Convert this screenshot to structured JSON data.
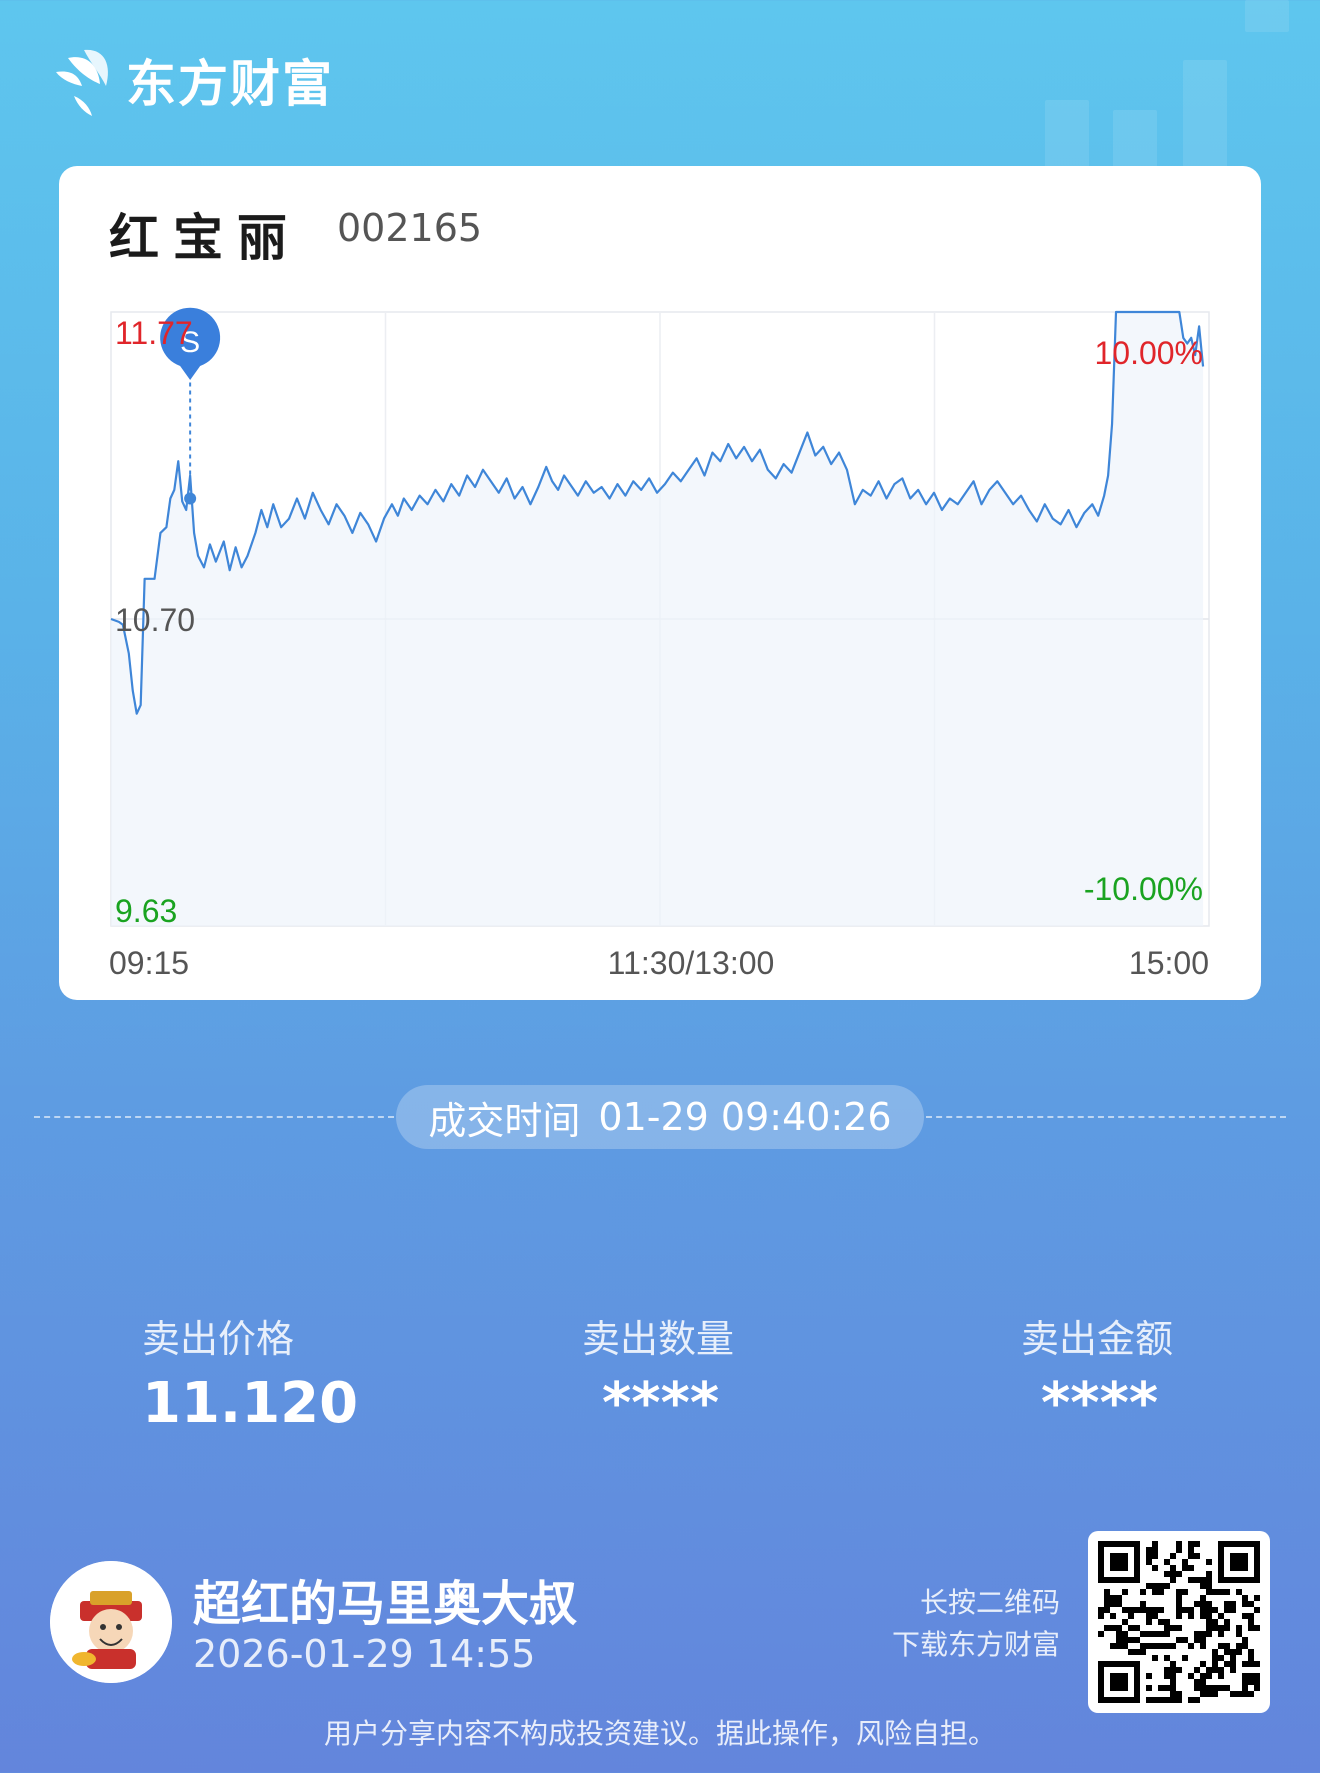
{
  "brand": {
    "name": "东方财富",
    "logo_icon": "eastmoney-leaf-icon"
  },
  "stock": {
    "name": "红宝丽",
    "code": "002165"
  },
  "chart_data": {
    "type": "line",
    "title": "",
    "xlabel": "",
    "ylabel": "",
    "x_ticks": [
      "09:15",
      "11:30/13:00",
      "15:00"
    ],
    "y_ticks_left": {
      "high": "11.77",
      "mid": "10.70",
      "low": "9.63"
    },
    "y_ticks_right": {
      "high": "10.00%",
      "low": "-10.00%"
    },
    "ylim": [
      9.63,
      11.77
    ],
    "prev_close": 10.7,
    "grid": true,
    "line_color": "#3f86d8",
    "high_color": "#e0252a",
    "low_color": "#1aa320",
    "series": [
      {
        "points": [
          [
            0,
            10.7
          ],
          [
            0.04,
            10.69
          ],
          [
            0.06,
            10.68
          ],
          [
            0.09,
            10.58
          ],
          [
            0.11,
            10.45
          ],
          [
            0.13,
            10.37
          ],
          [
            0.15,
            10.4
          ],
          [
            0.17,
            10.84
          ],
          [
            0.22,
            10.84
          ],
          [
            0.25,
            11.0
          ],
          [
            0.28,
            11.02
          ],
          [
            0.3,
            11.12
          ],
          [
            0.32,
            11.15
          ],
          [
            0.34,
            11.25
          ],
          [
            0.36,
            11.11
          ],
          [
            0.38,
            11.08
          ],
          [
            0.4,
            11.2
          ],
          [
            0.42,
            11.0
          ],
          [
            0.44,
            10.92
          ],
          [
            0.47,
            10.88
          ],
          [
            0.5,
            10.96
          ],
          [
            0.53,
            10.9
          ],
          [
            0.57,
            10.97
          ],
          [
            0.6,
            10.87
          ],
          [
            0.63,
            10.95
          ],
          [
            0.66,
            10.88
          ],
          [
            0.69,
            10.92
          ],
          [
            0.73,
            11.0
          ],
          [
            0.76,
            11.08
          ],
          [
            0.79,
            11.02
          ],
          [
            0.82,
            11.1
          ],
          [
            0.86,
            11.02
          ],
          [
            0.9,
            11.05
          ],
          [
            0.94,
            11.12
          ],
          [
            0.98,
            11.05
          ],
          [
            1.02,
            11.14
          ],
          [
            1.06,
            11.08
          ],
          [
            1.1,
            11.03
          ],
          [
            1.14,
            11.1
          ],
          [
            1.18,
            11.06
          ],
          [
            1.22,
            11.0
          ],
          [
            1.26,
            11.07
          ],
          [
            1.3,
            11.03
          ],
          [
            1.34,
            10.97
          ],
          [
            1.38,
            11.05
          ],
          [
            1.42,
            11.1
          ],
          [
            1.45,
            11.06
          ],
          [
            1.48,
            11.12
          ],
          [
            1.52,
            11.08
          ],
          [
            1.56,
            11.13
          ],
          [
            1.6,
            11.1
          ],
          [
            1.64,
            11.15
          ],
          [
            1.68,
            11.11
          ],
          [
            1.72,
            11.17
          ],
          [
            1.76,
            11.13
          ],
          [
            1.8,
            11.2
          ],
          [
            1.84,
            11.16
          ],
          [
            1.88,
            11.22
          ],
          [
            1.92,
            11.18
          ],
          [
            1.96,
            11.14
          ],
          [
            2.0,
            11.19
          ],
          [
            2.04,
            11.12
          ],
          [
            2.08,
            11.16
          ],
          [
            2.12,
            11.1
          ],
          [
            2.16,
            11.16
          ],
          [
            2.2,
            11.23
          ],
          [
            2.23,
            11.18
          ],
          [
            2.26,
            11.15
          ],
          [
            2.29,
            11.2
          ],
          [
            2.32,
            11.17
          ],
          [
            2.36,
            11.13
          ],
          [
            2.4,
            11.18
          ],
          [
            2.44,
            11.14
          ],
          [
            2.48,
            11.16
          ],
          [
            2.52,
            11.12
          ],
          [
            2.56,
            11.17
          ],
          [
            2.6,
            11.13
          ],
          [
            2.64,
            11.18
          ],
          [
            2.68,
            11.15
          ],
          [
            2.72,
            11.19
          ],
          [
            2.76,
            11.14
          ],
          [
            2.8,
            11.17
          ],
          [
            2.84,
            11.21
          ],
          [
            2.88,
            11.18
          ],
          [
            2.92,
            11.22
          ],
          [
            2.96,
            11.26
          ],
          [
            3.0,
            11.2
          ],
          [
            3.04,
            11.28
          ],
          [
            3.08,
            11.25
          ],
          [
            3.12,
            11.31
          ],
          [
            3.16,
            11.26
          ],
          [
            3.2,
            11.3
          ],
          [
            3.24,
            11.25
          ],
          [
            3.28,
            11.29
          ],
          [
            3.32,
            11.22
          ],
          [
            3.36,
            11.19
          ],
          [
            3.4,
            11.24
          ],
          [
            3.44,
            11.21
          ],
          [
            3.48,
            11.28
          ],
          [
            3.52,
            11.35
          ],
          [
            3.56,
            11.27
          ],
          [
            3.6,
            11.3
          ],
          [
            3.64,
            11.24
          ],
          [
            3.68,
            11.28
          ],
          [
            3.72,
            11.22
          ],
          [
            3.76,
            11.1
          ],
          [
            3.8,
            11.15
          ],
          [
            3.84,
            11.13
          ],
          [
            3.88,
            11.18
          ],
          [
            3.92,
            11.12
          ],
          [
            3.96,
            11.17
          ],
          [
            4.0,
            11.19
          ],
          [
            4.04,
            11.12
          ],
          [
            4.08,
            11.15
          ],
          [
            4.12,
            11.1
          ],
          [
            4.16,
            11.14
          ],
          [
            4.2,
            11.08
          ],
          [
            4.24,
            11.12
          ],
          [
            4.28,
            11.1
          ],
          [
            4.32,
            11.14
          ],
          [
            4.36,
            11.18
          ],
          [
            4.4,
            11.1
          ],
          [
            4.44,
            11.15
          ],
          [
            4.48,
            11.18
          ],
          [
            4.52,
            11.14
          ],
          [
            4.56,
            11.1
          ],
          [
            4.6,
            11.13
          ],
          [
            4.64,
            11.08
          ],
          [
            4.68,
            11.04
          ],
          [
            4.72,
            11.1
          ],
          [
            4.76,
            11.05
          ],
          [
            4.8,
            11.03
          ],
          [
            4.84,
            11.08
          ],
          [
            4.88,
            11.02
          ],
          [
            4.92,
            11.07
          ],
          [
            4.96,
            11.1
          ],
          [
            4.99,
            11.06
          ],
          [
            5.02,
            11.13
          ],
          [
            5.04,
            11.2
          ],
          [
            5.06,
            11.38
          ],
          [
            5.08,
            11.77
          ],
          [
            5.2,
            11.77
          ],
          [
            5.32,
            11.77
          ],
          [
            5.4,
            11.77
          ],
          [
            5.42,
            11.68
          ],
          [
            5.44,
            11.66
          ],
          [
            5.46,
            11.68
          ],
          [
            5.48,
            11.62
          ],
          [
            5.5,
            11.72
          ],
          [
            5.52,
            11.58
          ]
        ],
        "x_axis_note": "x in chart hours from 09:15 open (0) to 15:00 close (≈5.55)"
      }
    ],
    "marker": {
      "label": "S",
      "time": "09:40:26",
      "price": 11.12
    }
  },
  "trade": {
    "time_label": "成交时间",
    "time_value": "01-29 09:40:26",
    "price_label": "卖出价格",
    "price_value": "11.120",
    "qty_label": "卖出数量",
    "qty_value": "****",
    "amount_label": "卖出金额",
    "amount_value": "****"
  },
  "user": {
    "name": "超红的马里奥大叔",
    "date": "2026-01-29 14:55",
    "avatar_icon": "god-of-wealth-avatar-icon"
  },
  "qr": {
    "hint_line1": "长按二维码",
    "hint_line2": "下载东方财富",
    "icon": "qr-code-icon"
  },
  "disclaimer": "用户分享内容不构成投资建议。据此操作，风险自担。"
}
